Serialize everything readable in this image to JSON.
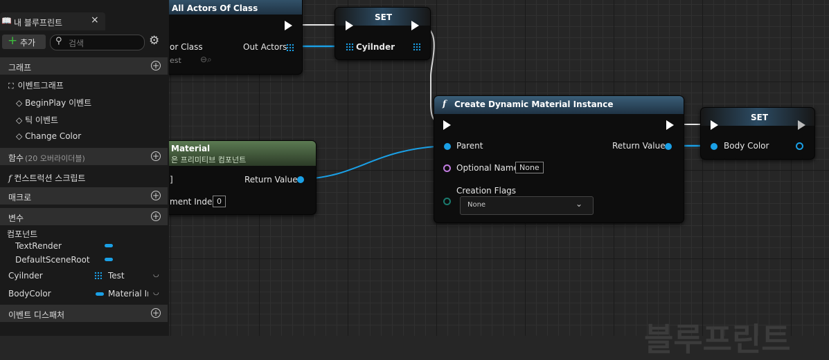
{
  "panel": {
    "tab_title": "내 블루프린트",
    "tab_close": "×",
    "add_label": "추가",
    "search_placeholder": "검색",
    "sections": {
      "graphs": "그래프",
      "functions": "함수",
      "functions_note": "(20 오버라이더블)",
      "macros": "매크로",
      "variables": "변수",
      "event_dispatchers": "이벤트 디스패처"
    },
    "graph_items": [
      "이벤트그래프",
      "BeginPlay 이벤트",
      "틱 이벤트",
      "Change Color"
    ],
    "construction_script": "컨스트럭션 스크립트",
    "components_label": "컴포넌트",
    "components": [
      "TextRender",
      "DefaultSceneRoot"
    ],
    "variables": [
      {
        "name": "Cyilnder",
        "type": "Test"
      },
      {
        "name": "BodyColor",
        "type": "Material Ir"
      }
    ]
  },
  "nodes": {
    "get_all_actors": {
      "title": "All Actors Of Class",
      "pin_left": "or Class",
      "pin_right": "Out Actors",
      "sub": "est"
    },
    "set_cylinder": {
      "title": "SET",
      "pin": "Cyilnder"
    },
    "material_node": {
      "title": "Material",
      "subtitle": "은 프리미티브 컴포넌트",
      "pin_left": "]",
      "return_label": "Return Value",
      "element_label": "ment Index",
      "element_value": "0"
    },
    "create_dmi": {
      "icon": "f",
      "title": "Create Dynamic Material Instance",
      "parent": "Parent",
      "return_label": "Return Value",
      "optional_name": "Optional Name",
      "optional_value": "None",
      "creation_flags": "Creation Flags",
      "flags_value": "None"
    },
    "set_body_color": {
      "title": "SET",
      "pin": "Body Color"
    }
  },
  "watermark": "블루프린트"
}
